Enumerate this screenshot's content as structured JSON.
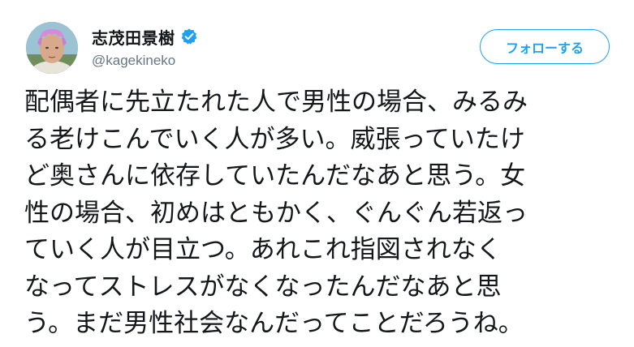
{
  "user": {
    "display_name": "志茂田景樹",
    "handle": "@kagekineko",
    "verified": true
  },
  "follow_button": {
    "label": "フォローする"
  },
  "tweet": {
    "lines": [
      "配偶者に先立たれた人で男性の場合、みるみ",
      "る老けこんでいく人が多い。威張っていたけ",
      "ど奥さんに依存していたんだなあと思う。女",
      "性の場合、初めはともかく、ぐんぐん若返っ",
      "ていく人が目立つ。あれこれ指図されなく",
      "なってストレスがなくなったんだなあと思",
      "う。まだ男性社会なんだってことだろうね。"
    ]
  },
  "colors": {
    "accent": "#1da1f2",
    "text": "#14171a",
    "secondary_text": "#657786"
  },
  "icons": {
    "verified": "verified-badge-icon",
    "avatar": "profile-photo"
  }
}
